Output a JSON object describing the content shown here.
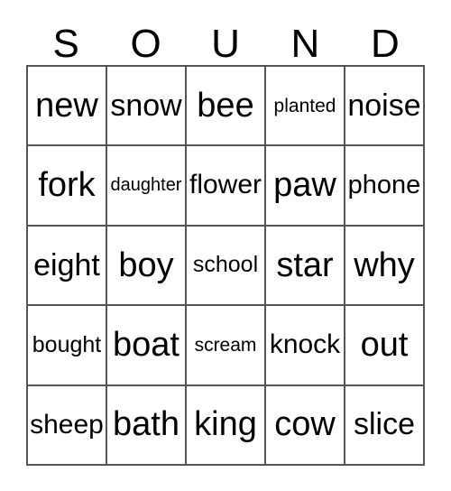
{
  "card": {
    "title_letters": [
      "S",
      "O",
      "U",
      "N",
      "D"
    ],
    "columns": 5,
    "rows": 5,
    "colors": {
      "background": "#ffffff",
      "text": "#000000",
      "grid_border": "#555555"
    },
    "cells": [
      [
        {
          "label": "new",
          "size": "xl"
        },
        {
          "label": "snow",
          "size": "lg"
        },
        {
          "label": "bee",
          "size": "xl"
        },
        {
          "label": "planted",
          "size": "xs"
        },
        {
          "label": "noise",
          "size": "lg"
        }
      ],
      [
        {
          "label": "fork",
          "size": "xl"
        },
        {
          "label": "daughter",
          "size": "xs"
        },
        {
          "label": "flower",
          "size": "md"
        },
        {
          "label": "paw",
          "size": "xl"
        },
        {
          "label": "phone",
          "size": "md"
        }
      ],
      [
        {
          "label": "eight",
          "size": "lg"
        },
        {
          "label": "boy",
          "size": "xl"
        },
        {
          "label": "school",
          "size": "sm"
        },
        {
          "label": "star",
          "size": "xl"
        },
        {
          "label": "why",
          "size": "xl"
        }
      ],
      [
        {
          "label": "bought",
          "size": "sm"
        },
        {
          "label": "boat",
          "size": "xl"
        },
        {
          "label": "scream",
          "size": "xs"
        },
        {
          "label": "knock",
          "size": "md"
        },
        {
          "label": "out",
          "size": "xl"
        }
      ],
      [
        {
          "label": "sheep",
          "size": "lg"
        },
        {
          "label": "bath",
          "size": "xl"
        },
        {
          "label": "king",
          "size": "xl"
        },
        {
          "label": "cow",
          "size": "xl"
        },
        {
          "label": "slice",
          "size": "lg"
        }
      ]
    ]
  }
}
